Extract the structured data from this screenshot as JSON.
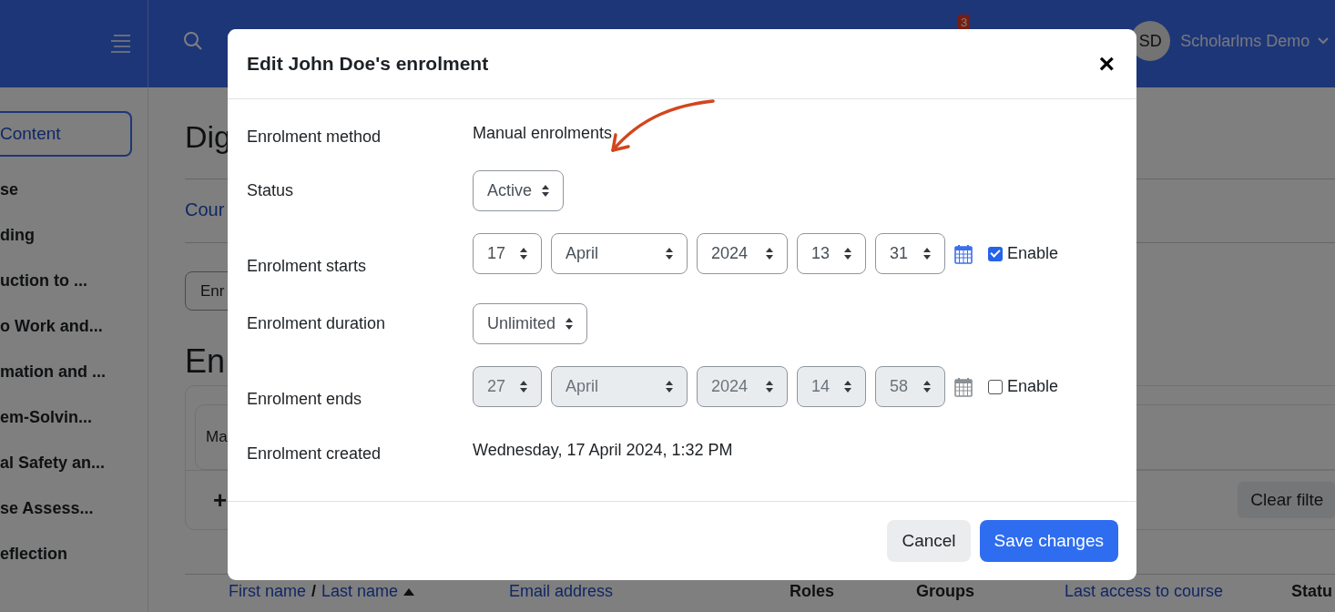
{
  "header": {
    "badge": "3",
    "avatar_initials": "SD",
    "user_name": "Scholarlms Demo"
  },
  "sidebar": {
    "button": "Content",
    "items": [
      "se",
      "ding",
      "uction to ...",
      "o Work and...",
      "mation and ...",
      "em-Solvin...",
      "al Safety an...",
      "se Assess...",
      "eflection"
    ]
  },
  "page": {
    "title": "Dig",
    "tab": "Cour",
    "select": "Enr",
    "heading": "En",
    "filter": "Ma",
    "add": "+",
    "clear": "Clear filte",
    "columns": [
      {
        "parts": [
          {
            "text": "First name",
            "link": true
          },
          {
            "text": "/",
            "link": false
          },
          {
            "text": "Last name",
            "link": true
          }
        ],
        "sorted": true
      },
      {
        "parts": [
          {
            "text": "Email address",
            "link": true
          }
        ],
        "sorted": false
      },
      {
        "parts": [
          {
            "text": "Roles",
            "link": false
          }
        ],
        "sorted": false
      },
      {
        "parts": [
          {
            "text": "Groups",
            "link": false
          }
        ],
        "sorted": false
      },
      {
        "parts": [
          {
            "text": "Last access to course",
            "link": true
          }
        ],
        "sorted": false
      },
      {
        "parts": [
          {
            "text": "Statu",
            "link": false
          }
        ],
        "sorted": false
      }
    ]
  },
  "dialog": {
    "title": "Edit John Doe's enrolment",
    "close": "×",
    "rows": [
      {
        "kind": "text",
        "label": "Enrolment method",
        "value": "Manual enrolments"
      },
      {
        "kind": "select",
        "label": "Status",
        "value": "Active"
      },
      {
        "kind": "date",
        "label": "Enrolment starts",
        "fields": [
          "17",
          "April",
          "2024",
          "13",
          "31"
        ],
        "checked": true,
        "enable_label": "Enable"
      },
      {
        "kind": "select",
        "label": "Enrolment duration",
        "value": "Unlimited"
      },
      {
        "kind": "date",
        "label": "Enrolment ends",
        "fields": [
          "27",
          "April",
          "2024",
          "14",
          "58"
        ],
        "checked": false,
        "enable_label": "Enable"
      },
      {
        "kind": "text",
        "label": "Enrolment created",
        "value": "Wednesday, 17 April 2024, 1:32 PM"
      }
    ],
    "buttons": [
      {
        "label": "Cancel",
        "kind": "secondary"
      },
      {
        "label": "Save changes",
        "kind": "primary"
      }
    ]
  }
}
